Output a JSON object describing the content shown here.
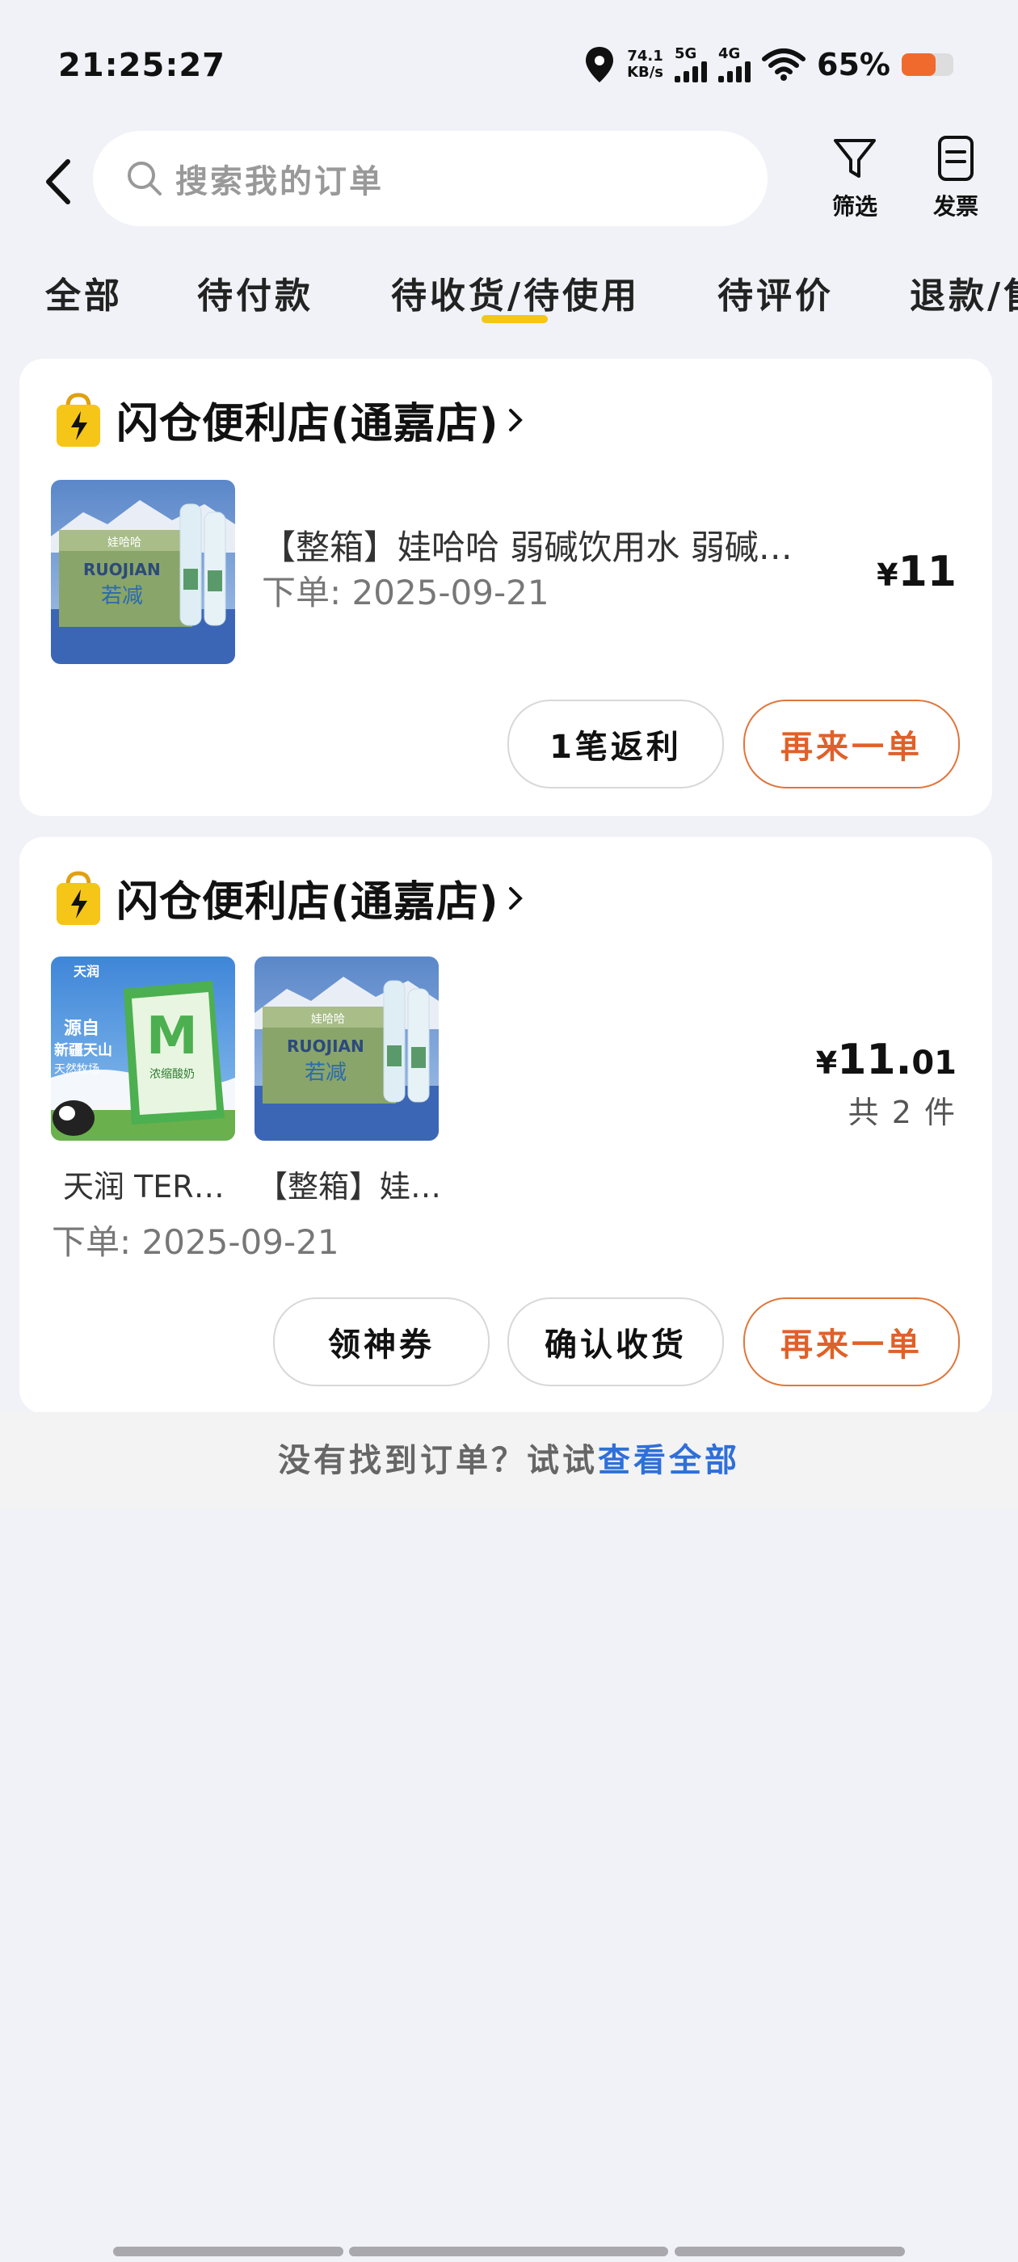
{
  "status_bar": {
    "time": "21:25:27",
    "net_speed_value": "74.1",
    "net_speed_unit": "KB/s",
    "sig1_label": "5G",
    "sig2_label": "4G",
    "battery_percent": "65%",
    "battery_level": 0.65,
    "battery_color": "#ef6a2c"
  },
  "header": {
    "search_placeholder": "搜索我的订单",
    "filter_label": "筛选",
    "invoice_label": "发票"
  },
  "tabs": [
    {
      "label": "全部"
    },
    {
      "label": "待付款"
    },
    {
      "label": "待收货/待使用",
      "active": true
    },
    {
      "label": "待评价"
    },
    {
      "label": "退款/售后"
    }
  ],
  "orders": [
    {
      "shop_name": "闪仓便利店(通嘉店)",
      "product_title": "【整箱】娃哈哈 弱碱饮用水 弱碱…",
      "order_date": "下单: 2025-09-21",
      "price_symbol": "¥",
      "price_int": "11",
      "price_dec": "",
      "buttons": [
        "1笔返利",
        "再来一单"
      ],
      "thumbs": [
        {
          "name": "water-case"
        }
      ]
    },
    {
      "shop_name": "闪仓便利店(通嘉店)",
      "thumb_names": [
        "天润 TER…",
        "【整箱】娃…"
      ],
      "order_date": "下单: 2025-09-21",
      "price_symbol": "¥",
      "price_int": "11.",
      "price_dec": "01",
      "quantity": "共 2 件",
      "buttons": [
        "领神券",
        "确认收货",
        "再来一单"
      ],
      "thumbs": [
        {
          "name": "yogurt-pack",
          "text_lines": [
            "源自",
            "新疆天山",
            "天然牧场"
          ],
          "brand": "天润",
          "pack_label": "浓缩酸奶"
        },
        {
          "name": "water-case"
        }
      ]
    }
  ],
  "water_pack": {
    "brand": "娃哈哈",
    "latin": "RUOJIAN",
    "cn": "若减"
  },
  "footer": {
    "prefix": "没有找到订单？试试",
    "link": "查看全部"
  },
  "colors": {
    "accent_orange": "#e0602a",
    "tab_underline": "#f5c518",
    "link_blue": "#2f6fd8",
    "background": "#f1f2f7"
  }
}
